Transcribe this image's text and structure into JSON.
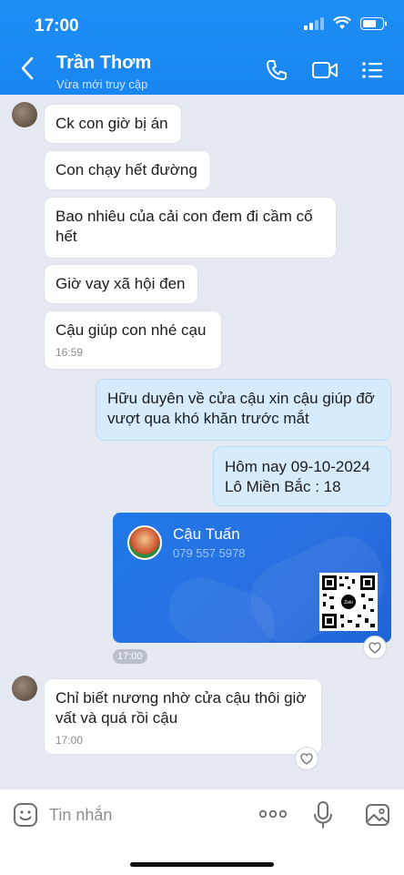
{
  "status": {
    "time": "17:00"
  },
  "header": {
    "name": "Trần Thơm",
    "subtitle": "Vừa mới truy cập"
  },
  "messages": [
    {
      "side": "in",
      "text": "Ck con giờ bị án"
    },
    {
      "side": "in",
      "text": "Con chạy hết đường"
    },
    {
      "side": "in",
      "text": "Bao nhiêu của cải con đem đi cầm cố hết"
    },
    {
      "side": "in",
      "text": "Giờ vay xã hội đen"
    },
    {
      "side": "in",
      "text": "Cậu giúp con nhé cạu",
      "time": "16:59"
    },
    {
      "side": "out",
      "text": "Hữu duyên về cửa cậu xin cậu giúp đỡ vượt qua khó khăn trước mắt"
    },
    {
      "side": "out",
      "line1": "Hôm nay 09-10-2024",
      "line2": "Lô Miền Bắc : 18"
    },
    {
      "side": "in",
      "text": "Chỉ biết nương nhờ cửa cậu thôi giờ vất và quá rồi cậu",
      "time": "17:00"
    }
  ],
  "contact_card": {
    "name": "Cậu Tuấn",
    "phone": "079 557 5978",
    "time": "17:00",
    "qr_label": "Zalo"
  },
  "composer": {
    "placeholder": "Tin nhắn"
  }
}
